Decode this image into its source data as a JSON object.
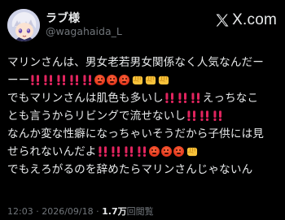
{
  "post": {
    "author": {
      "display_name": "ラブ様",
      "handle": "@wagahaida_L",
      "avatar_icon": "anime-character-avatar"
    },
    "brand": {
      "text": "X.com",
      "icon": "x-logo-icon"
    },
    "lines": [
      {
        "text": "マリンさんは、男女老若男女関係なく人気なんだー"
      },
      {
        "text": "ーー",
        "emoji_after": [
          "bang",
          "bang",
          "bang",
          "bang",
          "bang",
          "angry",
          "angry",
          "angry",
          "fist",
          "fist",
          "fist"
        ]
      },
      {
        "text": "でもマリンさんは肌色も多いし",
        "emoji_after": [
          "bang",
          "bang",
          "bang"
        ],
        "text2": "えっちなこ"
      },
      {
        "text": "とも言うからリビングで流せないし",
        "emoji_after": [
          "bang",
          "bang",
          "bang"
        ]
      },
      {
        "text": "なんか変な性癖になっちゃいそうだから子供には見"
      },
      {
        "text": "せられないんだよ",
        "emoji_after": [
          "bang",
          "bang",
          "bang",
          "bang",
          "angry",
          "angry",
          "angry",
          "fist"
        ]
      },
      {
        "text": "でもえろがるのを辞めたらマリンさんじゃないん"
      }
    ],
    "meta": {
      "time": "12:03",
      "separator": "·",
      "date": "2026/09/18",
      "views_count": "1.7万",
      "views_label": "回閲覧"
    }
  },
  "colors": {
    "background": "#000000",
    "text_primary": "#e7e9ea",
    "text_secondary": "#71767b",
    "bang_red": "#e0245e"
  }
}
